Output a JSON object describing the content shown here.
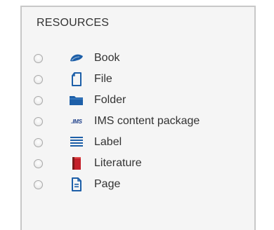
{
  "section": {
    "heading": "RESOURCES"
  },
  "items": [
    {
      "label": "Book",
      "icon": "book-icon"
    },
    {
      "label": "File",
      "icon": "file-icon"
    },
    {
      "label": "Folder",
      "icon": "folder-icon"
    },
    {
      "label": "IMS content package",
      "icon": "ims-icon",
      "icon_text": ".IMS"
    },
    {
      "label": "Label",
      "icon": "label-icon"
    },
    {
      "label": "Literature",
      "icon": "literature-icon"
    },
    {
      "label": "Page",
      "icon": "page-icon"
    }
  ],
  "colors": {
    "icon_blue": "#1d5fa8",
    "literature_red": "#c4202a",
    "text": "#333333",
    "panel_bg": "#f5f5f5",
    "border": "#c8c8c8"
  }
}
